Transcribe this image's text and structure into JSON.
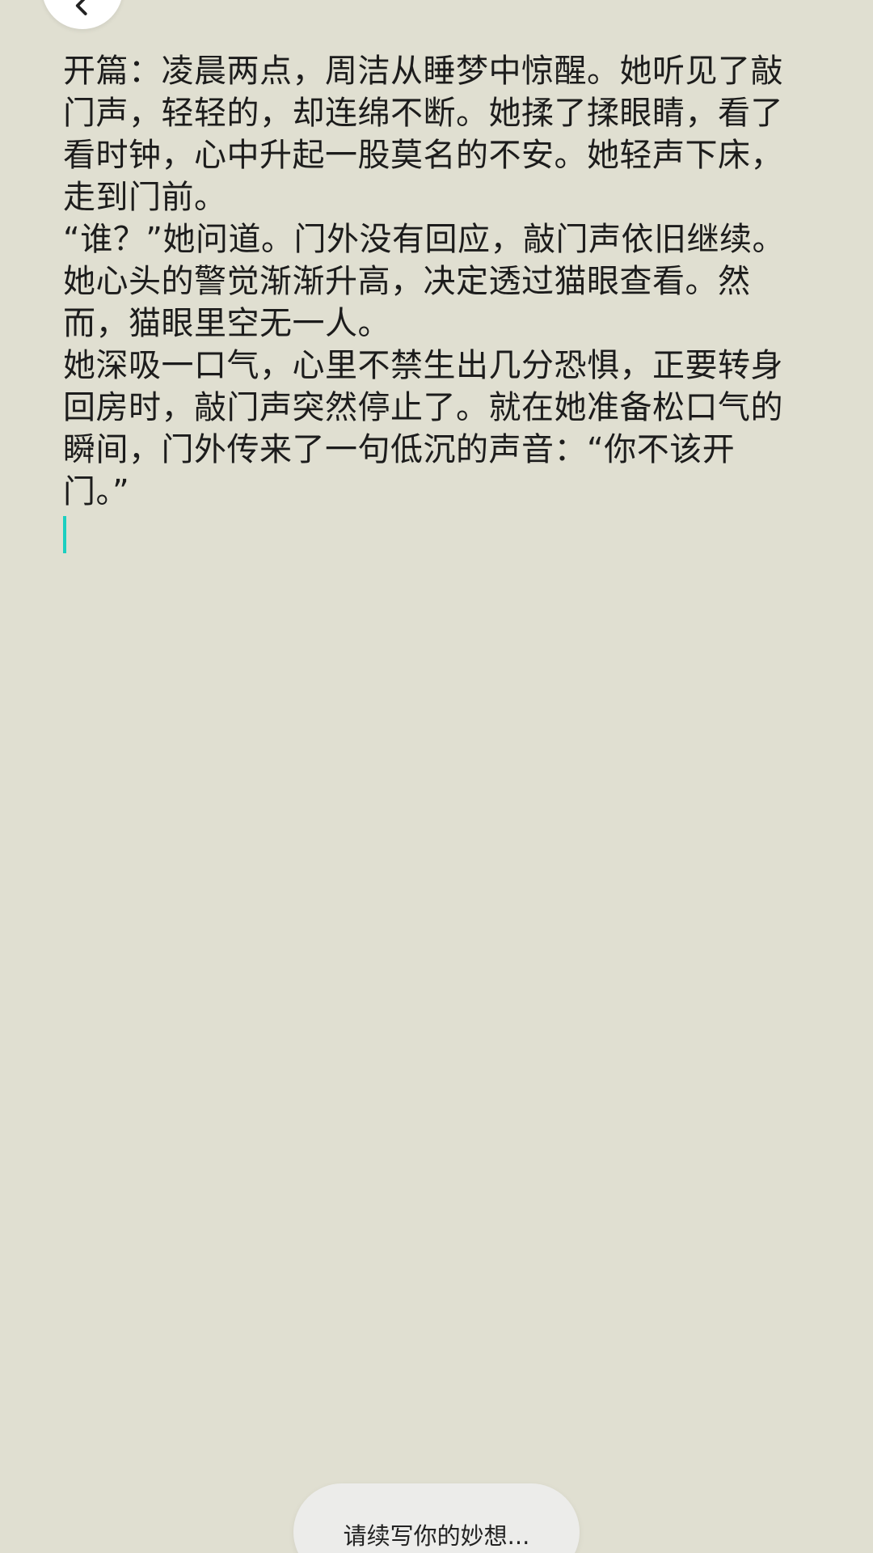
{
  "header": {
    "back_icon": "chevron-left-icon"
  },
  "editor": {
    "paragraphs": [
      "开篇：凌晨两点，周洁从睡梦中惊醒。她听见了敲门声，轻轻的，却连绵不断。她揉了揉眼睛，看了看时钟，心中升起一股莫名的不安。她轻声下床，走到门前。",
      "“谁？”她问道。门外没有回应，敲门声依旧继续。她心头的警觉渐渐升高，决定透过猫眼查看。然而，猫眼里空无一人。",
      "她深吸一口气，心里不禁生出几分恐惧，正要转身回房时，敲门声突然停止了。就在她准备松口气的瞬间，门外传来了一句低沉的声音：“你不该开门。”"
    ],
    "caret_color": "#1ccfc0"
  },
  "footer": {
    "continue_label": "请续写你的妙想..."
  }
}
